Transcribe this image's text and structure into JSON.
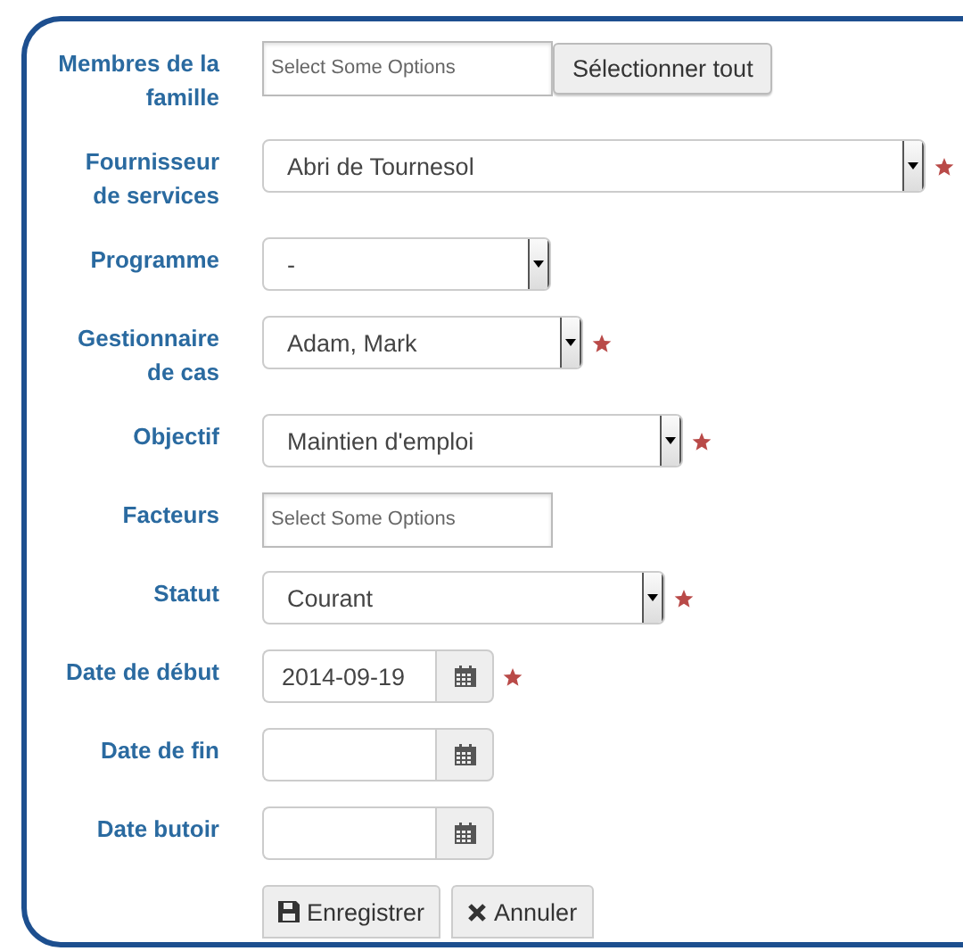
{
  "fields": [
    {
      "label": "Membres de la\nfamille",
      "kind": "multiselect",
      "placeholder": "Select Some Options",
      "button": "Sélectionner tout",
      "required": false
    },
    {
      "label": "Fournisseur\nde services",
      "kind": "select",
      "value": "Abri de Tournesol",
      "required": true
    },
    {
      "label": "Programme",
      "kind": "select",
      "value": "-",
      "required": false
    },
    {
      "label": "Gestionnaire\nde cas",
      "kind": "select",
      "value": "Adam, Mark",
      "required": true
    },
    {
      "label": "Objectif",
      "kind": "select",
      "value": "Maintien d'emploi",
      "required": true
    },
    {
      "label": "Facteurs",
      "kind": "multiselect",
      "placeholder": "Select Some Options",
      "required": false
    },
    {
      "label": "Statut",
      "kind": "select",
      "value": "Courant",
      "required": true
    },
    {
      "label": "Date de début",
      "kind": "date",
      "value": "2014-09-19",
      "required": true
    },
    {
      "label": "Date de fin",
      "kind": "date",
      "required": false
    },
    {
      "label": "Date butoir",
      "kind": "date",
      "required": false
    }
  ],
  "actions": [
    {
      "label": "Enregistrer",
      "kind": "save"
    },
    {
      "label": "Annuler",
      "kind": "cancel"
    }
  ]
}
